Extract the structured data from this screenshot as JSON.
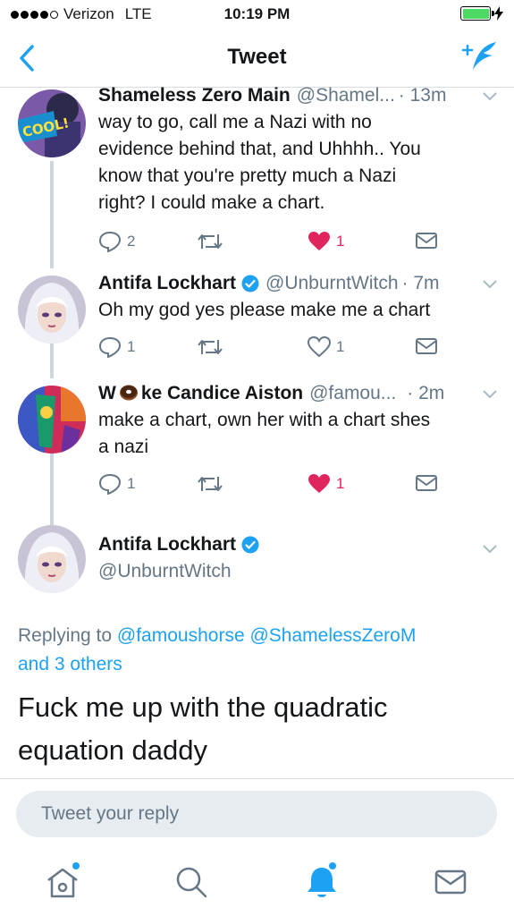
{
  "status_bar": {
    "carrier": "Verizon",
    "network": "LTE",
    "time": "10:19 PM"
  },
  "nav": {
    "title": "Tweet"
  },
  "replies": [
    {
      "name": "Shameless Zero Main",
      "handle": "@Shamel...",
      "time": "· 13m",
      "text_lines": [
        "way to go, call me a Nazi with no",
        "evidence behind that, and Uhhhh.. You",
        "know that you're pretty much a Nazi",
        "right? I could make a chart."
      ],
      "reply_count": "2",
      "like_count": "1",
      "liked": true
    },
    {
      "name": "Antifa Lockhart",
      "handle": "@UnburntWitch",
      "time": "· 7m",
      "text_lines": [
        "Oh my god yes please make me a chart"
      ],
      "reply_count": "1",
      "like_count": "1",
      "liked": false
    },
    {
      "name_prefix": "W",
      "name_suffix": "ke Candice Aiston",
      "handle": "@famou...",
      "time": "· 2m",
      "text_lines": [
        "make a chart, own her with a chart shes",
        "a nazi"
      ],
      "reply_count": "1",
      "like_count": "1",
      "liked": true
    }
  ],
  "main_tweet": {
    "name": "Antifa Lockhart",
    "handle": "@UnburntWitch",
    "replying_label": "Replying to",
    "replying_to_1": "@famoushorse",
    "replying_to_2": "@ShamelessZeroM",
    "replying_others": "and 3 others",
    "text_lines": [
      "Fuck me up with the quadratic",
      "equation daddy"
    ]
  },
  "reply_input": {
    "placeholder": "Tweet your reply"
  },
  "tabs": [
    "home-icon",
    "search-icon",
    "notifications-icon",
    "messages-icon"
  ],
  "colors": {
    "accent": "#1da1f2",
    "like": "#e0245e",
    "muted": "#657786"
  }
}
